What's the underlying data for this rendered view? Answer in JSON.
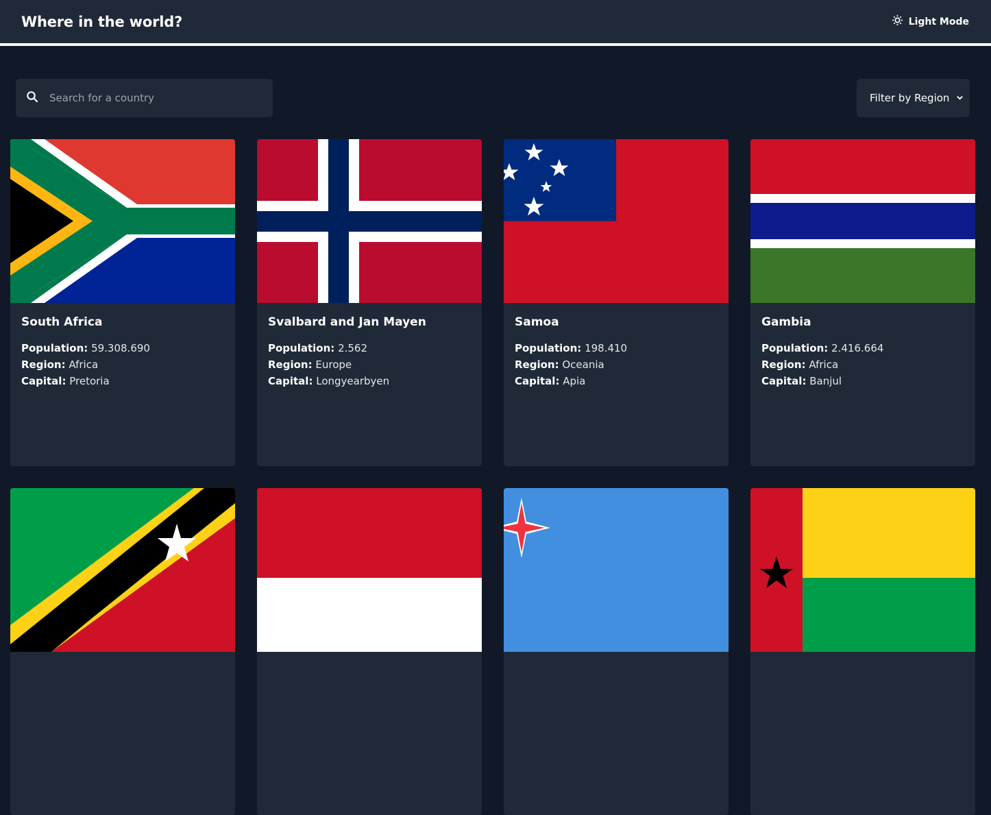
{
  "header": {
    "title": "Where in the world?",
    "theme_toggle_label": "Light Mode"
  },
  "search": {
    "placeholder": "Search for a country",
    "value": ""
  },
  "filter": {
    "label": "Filter by Region"
  },
  "field_labels": {
    "population": "Population:",
    "region": "Region:",
    "capital": "Capital:"
  },
  "countries": [
    {
      "name": "South Africa",
      "population": "59.308.690",
      "region": "Africa",
      "capital": "Pretoria"
    },
    {
      "name": "Svalbard and Jan Mayen",
      "population": "2.562",
      "region": "Europe",
      "capital": "Longyearbyen"
    },
    {
      "name": "Samoa",
      "population": "198.410",
      "region": "Oceania",
      "capital": "Apia"
    },
    {
      "name": "Gambia",
      "population": "2.416.664",
      "region": "Africa",
      "capital": "Banjul"
    },
    {
      "name": "",
      "population": "",
      "region": "",
      "capital": ""
    },
    {
      "name": "",
      "population": "",
      "region": "",
      "capital": ""
    },
    {
      "name": "",
      "population": "",
      "region": "",
      "capital": ""
    },
    {
      "name": "",
      "population": "",
      "region": "",
      "capital": ""
    }
  ],
  "colors": {
    "background": "#111827",
    "surface": "#1f2937",
    "text": "#ffffff",
    "placeholder": "#9ca3af"
  }
}
